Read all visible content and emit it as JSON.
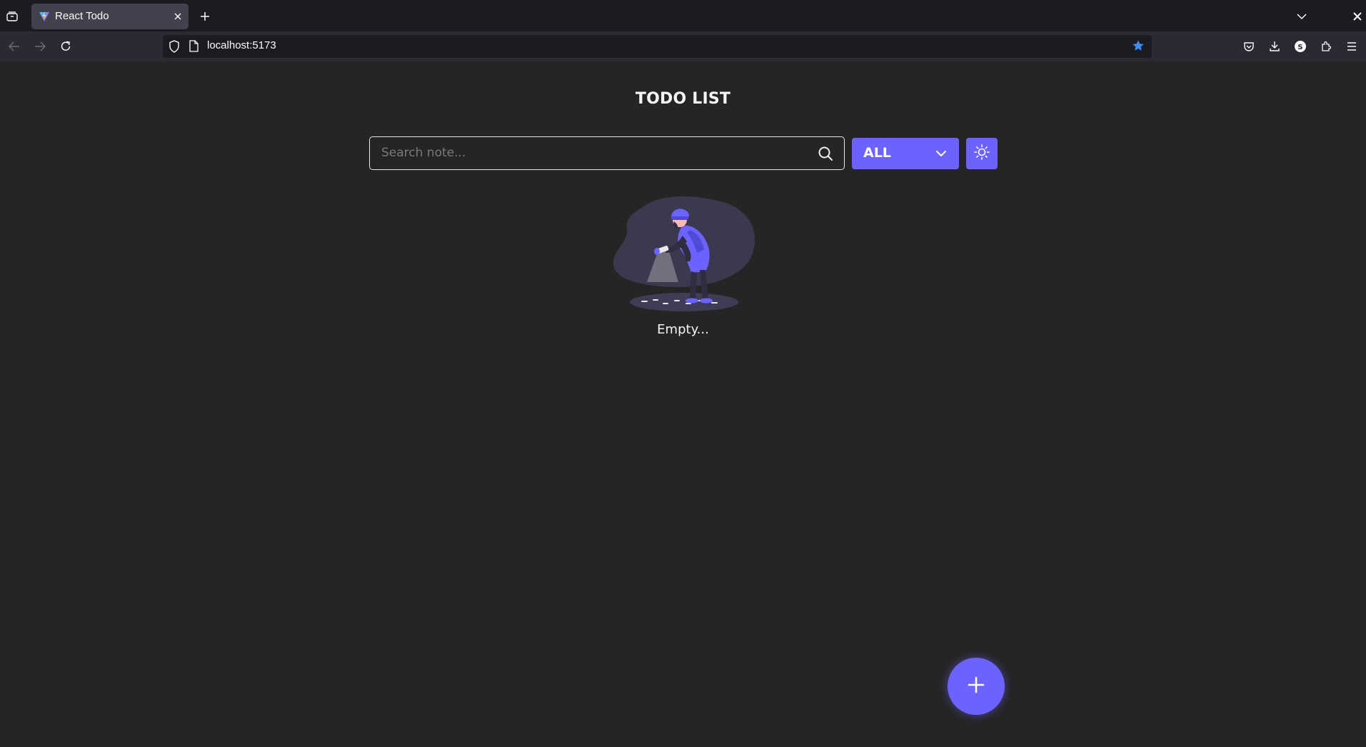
{
  "browser": {
    "tab": {
      "title": "React Todo"
    },
    "url": "localhost:5173"
  },
  "app": {
    "title": "TODO LIST",
    "search": {
      "placeholder": "Search note...",
      "value": ""
    },
    "filter": {
      "selected": "ALL"
    },
    "empty_text": "Empty...",
    "accent_color": "#6c63ff",
    "background_color": "#252525"
  },
  "icons": {
    "theme_toggle": "sun-icon",
    "add": "plus-icon",
    "search": "search-icon",
    "filter": "chevron-down-icon"
  }
}
